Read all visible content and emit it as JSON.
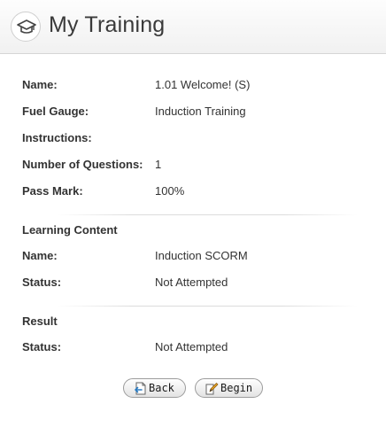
{
  "header": {
    "title": "My Training",
    "icon": "training-cap-icon"
  },
  "details": {
    "name_label": "Name:",
    "name_value": "1.01 Welcome! (S)",
    "fuel_gauge_label": "Fuel Gauge:",
    "fuel_gauge_value": "Induction Training",
    "instructions_label": "Instructions:",
    "instructions_value": "",
    "questions_label": "Number of Questions:",
    "questions_value": "1",
    "pass_mark_label": "Pass Mark:",
    "pass_mark_value": "100%"
  },
  "learning_content": {
    "title": "Learning Content",
    "name_label": "Name:",
    "name_value": "Induction SCORM",
    "status_label": "Status:",
    "status_value": "Not Attempted"
  },
  "result": {
    "title": "Result",
    "status_label": "Status:",
    "status_value": "Not Attempted"
  },
  "buttons": {
    "back_label": "Back",
    "back_icon": "back-page-icon",
    "begin_label": "Begin",
    "begin_icon": "edit-pencil-icon"
  }
}
